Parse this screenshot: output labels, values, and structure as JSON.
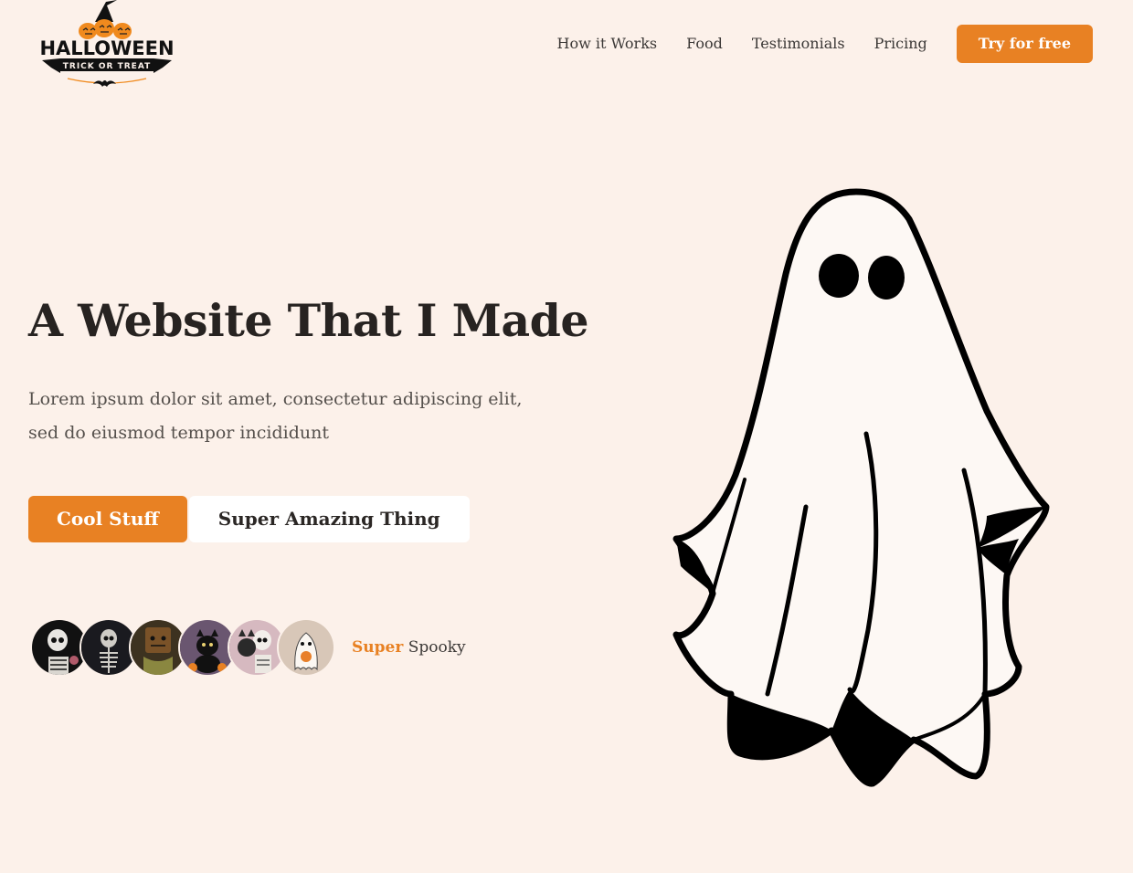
{
  "header": {
    "logo": {
      "title": "HALLOWEEN",
      "subtitle": "TRICK OR TREAT"
    },
    "nav": [
      {
        "label": "How it Works"
      },
      {
        "label": "Food"
      },
      {
        "label": "Testimonials"
      },
      {
        "label": "Pricing"
      }
    ],
    "cta_label": "Try for free"
  },
  "hero": {
    "title": "A Website That I Made",
    "description": "Lorem ipsum dolor sit amet, consectetur adipiscing elit, sed do eiusmod tempor incididunt",
    "primary_button": "Cool Stuff",
    "secondary_button": "Super Amazing Thing"
  },
  "social_proof": {
    "avatars": [
      "skeleton-avatar",
      "skeleton-avatar",
      "scarecrow-avatar",
      "cat-avatar",
      "skeleton-cat-avatar",
      "ghost-avatar"
    ],
    "tagline_accent": "Super",
    "tagline_rest": "Spooky"
  },
  "colors": {
    "background": "#fcf1ea",
    "accent": "#e88123",
    "text": "#272321"
  },
  "illustration": "ghost-illustration"
}
